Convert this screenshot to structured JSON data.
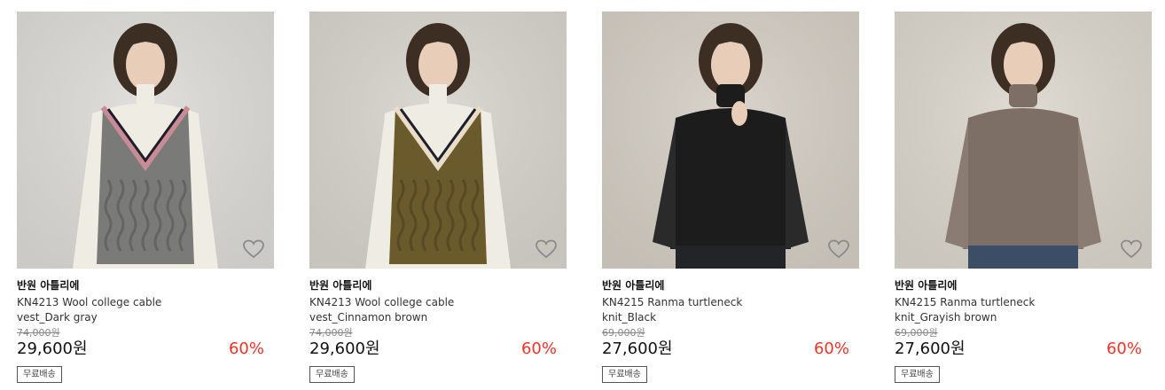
{
  "products": [
    {
      "brand": "반원 아틀리에",
      "name": "KN4213 Wool college cable vest_Dark gray",
      "original_price": "74,000원",
      "price": "29,600원",
      "discount": "60%",
      "shipping_badge": "무료배송",
      "wishlist_icon": "heart-outline-icon",
      "colors": {
        "bg": "#dedcd8",
        "garment": "#7a7a78",
        "inner": "#efece4",
        "trim": "#c98b95"
      }
    },
    {
      "brand": "반원 아틀리에",
      "name": "KN4213 Wool college cable vest_Cinnamon brown",
      "original_price": "74,000원",
      "price": "29,600원",
      "discount": "60%",
      "shipping_badge": "무료배송",
      "wishlist_icon": "heart-outline-icon",
      "colors": {
        "bg": "#d8d4cd",
        "garment": "#6a5a2c",
        "inner": "#efece4",
        "trim": "#e8ddc6"
      }
    },
    {
      "brand": "반원 아틀리에",
      "name": "KN4215 Ranma turtleneck knit_Black",
      "original_price": "69,000원",
      "price": "27,600원",
      "discount": "60%",
      "shipping_badge": "무료배송",
      "wishlist_icon": "heart-outline-icon",
      "colors": {
        "bg": "#d5cfc5",
        "garment": "#1c1c1c",
        "inner": "#1c1c1c",
        "trim": "#2a2a2a"
      }
    },
    {
      "brand": "반원 아틀리에",
      "name": "KN4215 Ranma turtleneck knit_Grayish brown",
      "original_price": "69,000원",
      "price": "27,600원",
      "discount": "60%",
      "shipping_badge": "무료배송",
      "wishlist_icon": "heart-outline-icon",
      "colors": {
        "bg": "#dcd7cd",
        "garment": "#7d6f66",
        "inner": "#7d6f66",
        "trim": "#8a7c72"
      }
    }
  ]
}
